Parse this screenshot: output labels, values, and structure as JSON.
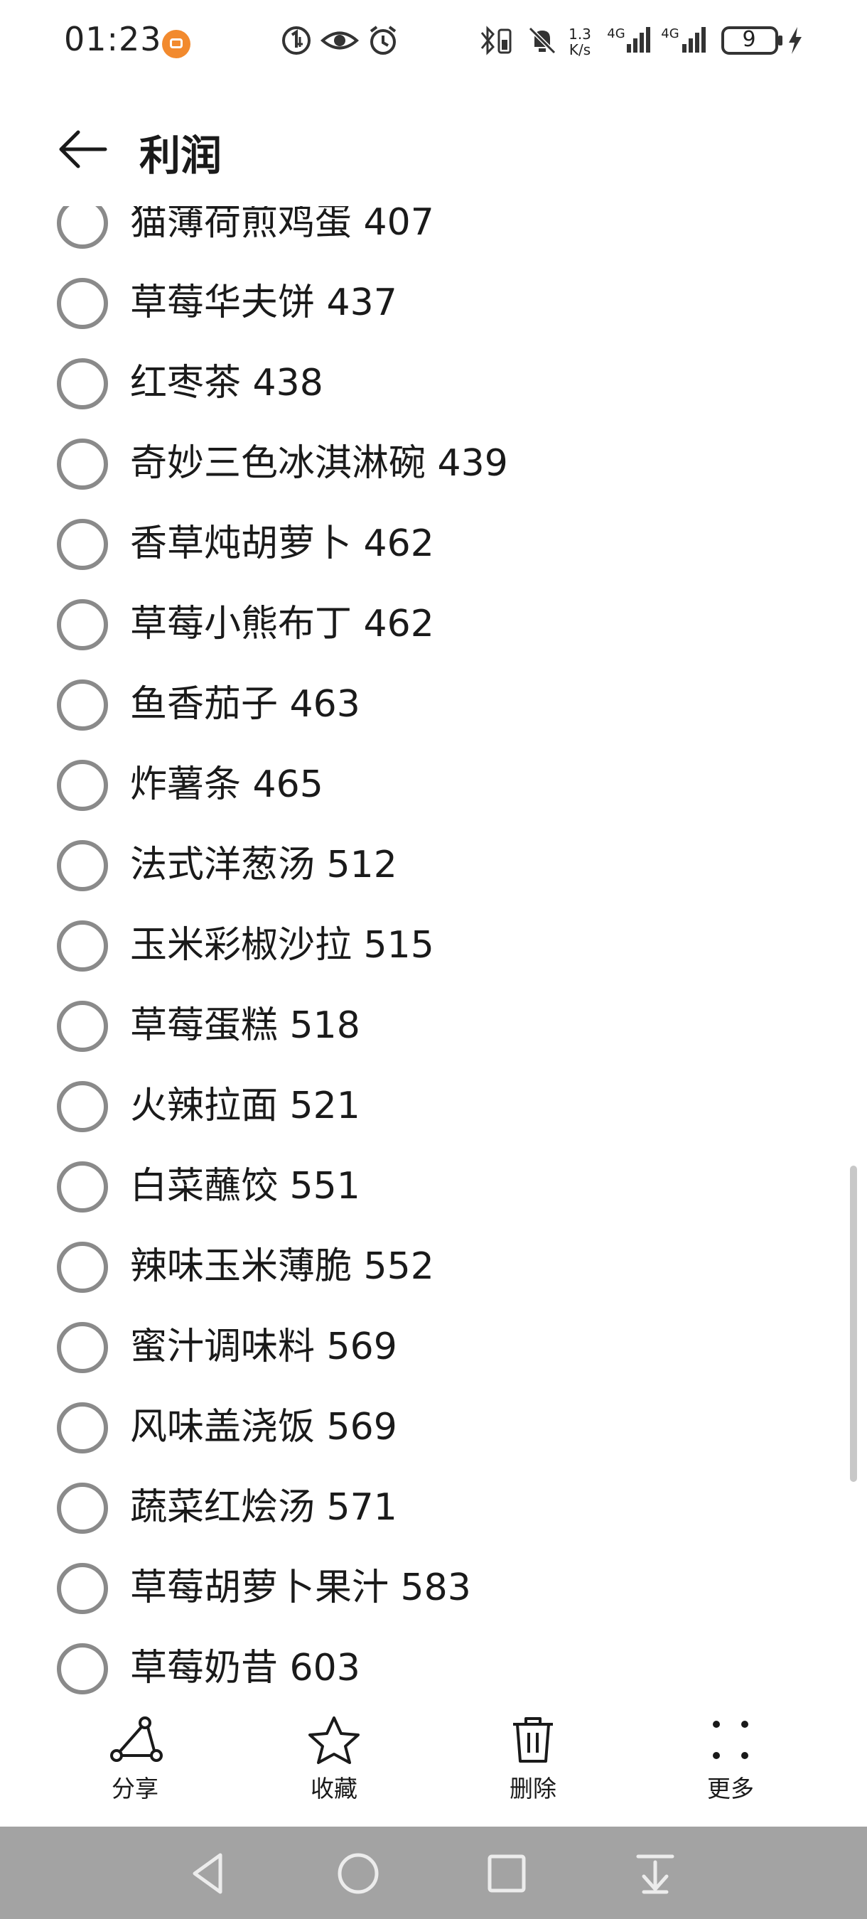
{
  "status_bar": {
    "time": "01:23",
    "network_speed_value": "1.3",
    "network_speed_unit": "K/s",
    "signal1_label": "4G",
    "signal2_label": "4G",
    "battery_level": "9"
  },
  "header": {
    "title": "利润"
  },
  "items": [
    {
      "label": "猫薄荷煎鸡蛋 407"
    },
    {
      "label": "草莓华夫饼 437"
    },
    {
      "label": "红枣茶 438"
    },
    {
      "label": "奇妙三色冰淇淋碗 439"
    },
    {
      "label": "香草炖胡萝卜 462"
    },
    {
      "label": "草莓小熊布丁 462"
    },
    {
      "label": "鱼香茄子 463"
    },
    {
      "label": "炸薯条 465"
    },
    {
      "label": "法式洋葱汤 512"
    },
    {
      "label": "玉米彩椒沙拉 515"
    },
    {
      "label": "草莓蛋糕 518"
    },
    {
      "label": "火辣拉面 521"
    },
    {
      "label": "白菜蘸饺 551"
    },
    {
      "label": "辣味玉米薄脆 552"
    },
    {
      "label": "蜜汁调味料 569"
    },
    {
      "label": "风味盖浇饭 569"
    },
    {
      "label": "蔬菜红烩汤 571"
    },
    {
      "label": "草莓胡萝卜果汁 583"
    },
    {
      "label": "草莓奶昔 603"
    }
  ],
  "toolbar": {
    "share_label": "分享",
    "favorite_label": "收藏",
    "delete_label": "删除",
    "more_label": "更多"
  },
  "icons": {
    "back": "arrow-left-icon",
    "share": "share-icon",
    "favorite": "star-icon",
    "delete": "trash-icon",
    "more": "more-dots-icon",
    "nav_back": "triangle-back-icon",
    "nav_home": "circle-home-icon",
    "nav_recents": "square-recents-icon",
    "nav_notifications": "pull-down-icon"
  },
  "colors": {
    "background": "#ffffff",
    "text": "#1a1a1a",
    "radio_border": "#8a8a8a",
    "navbar": "#a3a3a3",
    "status_badge": "#f28a2e"
  }
}
